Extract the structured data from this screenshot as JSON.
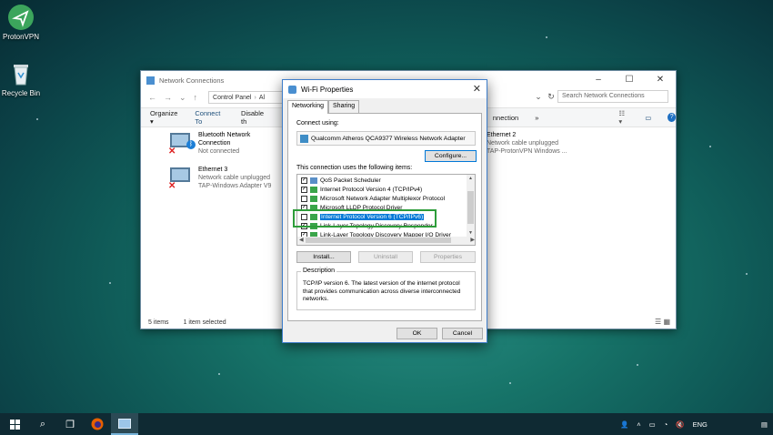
{
  "desktop": {
    "icons": [
      {
        "label": "ProtonVPN",
        "icon": "protonvpn-icon"
      },
      {
        "label": "Recycle Bin",
        "icon": "recycle-bin-icon"
      }
    ]
  },
  "explorer": {
    "title": "Network Connections",
    "breadcrumb": [
      "Control Panel",
      "Al"
    ],
    "search_placeholder": "Search Network Connections",
    "commands": [
      "Organize ▾",
      "Connect To",
      "Disable th",
      "nnection",
      "»"
    ],
    "items": [
      {
        "name": "Bluetooth Network",
        "name2": "Connection",
        "status": "Not connected",
        "device": ""
      },
      {
        "name": "Ethernet 3",
        "name2": "",
        "status": "Network cable unplugged",
        "device": "TAP-Windows Adapter V9"
      },
      {
        "name": "Ethernet 2",
        "name2": "",
        "status": "Network cable unplugged",
        "device": "TAP-ProtonVPN Windows ..."
      }
    ],
    "status": {
      "count": "5 items",
      "selected": "1 item selected"
    }
  },
  "dialog": {
    "title": "Wi-Fi Properties",
    "tabs": [
      "Networking",
      "Sharing"
    ],
    "connect_using_label": "Connect using:",
    "adapter": "Qualcomm Atheros QCA9377 Wireless Network Adapter",
    "configure_label": "Configure...",
    "items_label": "This connection uses the following items:",
    "items": [
      {
        "label": "QoS Packet Scheduler",
        "checked": true,
        "selected": false
      },
      {
        "label": "Internet Protocol Version 4 (TCP/IPv4)",
        "checked": true,
        "selected": false
      },
      {
        "label": "Microsoft Network Adapter Multiplexor Protocol",
        "checked": false,
        "selected": false
      },
      {
        "label": "Microsoft LLDP Protocol Driver",
        "checked": true,
        "selected": false
      },
      {
        "label": "Internet Protocol Version 6 (TCP/IPv6)",
        "checked": false,
        "selected": true
      },
      {
        "label": "Link-Layer Topology Discovery Responder",
        "checked": true,
        "selected": false
      },
      {
        "label": "Link-Layer Topology Discovery Mapper I/O Driver",
        "checked": true,
        "selected": false
      }
    ],
    "install_label": "Install...",
    "uninstall_label": "Uninstall",
    "properties_label": "Properties",
    "description_caption": "Description",
    "description_text": "TCP/IP version 6. The latest version of the internet protocol that provides communication across diverse interconnected networks.",
    "ok_label": "OK",
    "cancel_label": "Cancel"
  },
  "taskbar": {
    "language": "ENG",
    "colors": {
      "bg": "#0f2a33",
      "accent": "#0078d7",
      "highlight": "#2e9d3a"
    }
  }
}
